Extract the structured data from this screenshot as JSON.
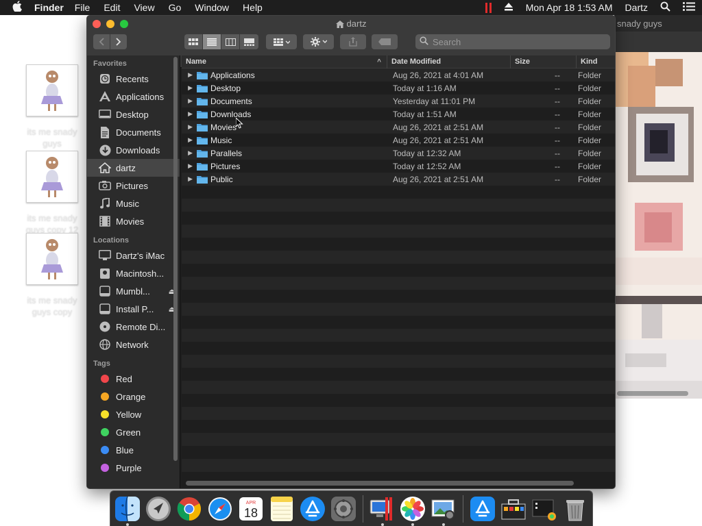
{
  "menubar": {
    "app_name": "Finder",
    "menus": [
      "File",
      "Edit",
      "View",
      "Go",
      "Window",
      "Help"
    ],
    "clock": "Mon Apr 18  1:53 AM",
    "user": "Dartz"
  },
  "desktop": {
    "icons": [
      {
        "label": "its me snady guys"
      },
      {
        "label": "its me snady guys copy 12"
      },
      {
        "label": "its me snady guys copy"
      }
    ]
  },
  "background_window": {
    "title": "snady guys"
  },
  "finder": {
    "title": "dartz",
    "search_placeholder": "Search",
    "sidebar": {
      "favorites_title": "Favorites",
      "favorites": [
        {
          "label": "Recents",
          "icon": "recents-icon"
        },
        {
          "label": "Applications",
          "icon": "applications-icon"
        },
        {
          "label": "Desktop",
          "icon": "desktop-icon"
        },
        {
          "label": "Documents",
          "icon": "documents-icon"
        },
        {
          "label": "Downloads",
          "icon": "downloads-icon"
        },
        {
          "label": "dartz",
          "icon": "home-icon",
          "selected": true
        },
        {
          "label": "Pictures",
          "icon": "pictures-icon"
        },
        {
          "label": "Music",
          "icon": "music-icon"
        },
        {
          "label": "Movies",
          "icon": "movies-icon"
        }
      ],
      "locations_title": "Locations",
      "locations": [
        {
          "label": "Dartz's iMac",
          "icon": "imac-icon",
          "eject": false
        },
        {
          "label": "Macintosh...",
          "icon": "hard-drive-icon",
          "eject": false
        },
        {
          "label": "Mumbl...",
          "icon": "external-drive-icon",
          "eject": true
        },
        {
          "label": "Install P...",
          "icon": "external-drive-icon",
          "eject": true
        },
        {
          "label": "Remote Di...",
          "icon": "remote-disc-icon",
          "eject": false
        },
        {
          "label": "Network",
          "icon": "network-icon",
          "eject": false
        }
      ],
      "tags_title": "Tags",
      "tags": [
        {
          "label": "Red",
          "color": "#f0464b"
        },
        {
          "label": "Orange",
          "color": "#f5a623"
        },
        {
          "label": "Yellow",
          "color": "#f7e02a"
        },
        {
          "label": "Green",
          "color": "#3fd360"
        },
        {
          "label": "Blue",
          "color": "#3b8cf5"
        },
        {
          "label": "Purple",
          "color": "#c462e0"
        }
      ]
    },
    "columns": {
      "name": "Name",
      "date": "Date Modified",
      "size": "Size",
      "kind": "Kind"
    },
    "rows": [
      {
        "name": "Applications",
        "date": "Aug 26, 2021 at 4:01 AM",
        "size": "--",
        "kind": "Folder"
      },
      {
        "name": "Desktop",
        "date": "Today at 1:16 AM",
        "size": "--",
        "kind": "Folder"
      },
      {
        "name": "Documents",
        "date": "Yesterday at 11:01 PM",
        "size": "--",
        "kind": "Folder"
      },
      {
        "name": "Downloads",
        "date": "Today at 1:51 AM",
        "size": "--",
        "kind": "Folder"
      },
      {
        "name": "Movies",
        "date": "Aug 26, 2021 at 2:51 AM",
        "size": "--",
        "kind": "Folder"
      },
      {
        "name": "Music",
        "date": "Aug 26, 2021 at 2:51 AM",
        "size": "--",
        "kind": "Folder"
      },
      {
        "name": "Parallels",
        "date": "Today at 12:32 AM",
        "size": "--",
        "kind": "Folder"
      },
      {
        "name": "Pictures",
        "date": "Today at 12:52 AM",
        "size": "--",
        "kind": "Folder"
      },
      {
        "name": "Public",
        "date": "Aug 26, 2021 at 2:51 AM",
        "size": "--",
        "kind": "Folder"
      }
    ]
  },
  "dock": {
    "calendar_month": "APR",
    "calendar_day": "18",
    "apps": [
      "finder",
      "launchpad",
      "chrome",
      "safari",
      "calendar",
      "notes",
      "app-store",
      "system-preferences",
      "parallels-desktop",
      "photos",
      "preview",
      "app-store-2",
      "toolbox",
      "folder-stack",
      "trash"
    ]
  },
  "colors": {
    "folder": "#4ea3e0",
    "accent": "#3b8cf5"
  }
}
